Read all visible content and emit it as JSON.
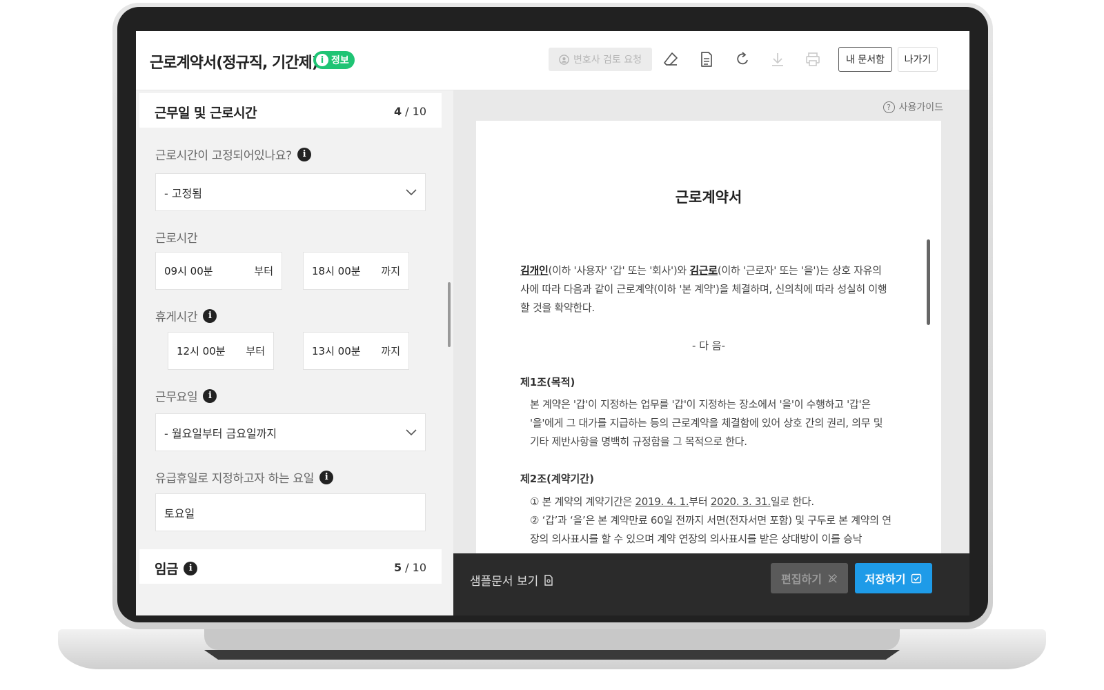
{
  "header": {
    "title": "근로계약서(정규직, 기간제)",
    "info_badge": "정보",
    "lawyer_review": "변호사 검토 요청",
    "my_docs": "내 문서함",
    "exit": "나가기"
  },
  "section4": {
    "title": "근무일 및 근로시간",
    "progress_current": "4",
    "progress_total": " / 10",
    "q_fixed": "근로시간이 고정되어있나요?",
    "fixed_value": "- 고정됨",
    "work_hours_label": "근로시간",
    "work_from": "09시 00분",
    "work_from_suffix": "부터",
    "work_to": "18시 00분",
    "work_to_suffix": "까지",
    "break_label": "휴게시간",
    "break_from": "12시 00분",
    "break_from_suffix": "부터",
    "break_to": "13시 00분",
    "break_to_suffix": "까지",
    "workdays_label": "근무요일",
    "workdays_value": "- 월요일부터 금요일까지",
    "paid_holiday_label": "유급휴일로 지정하고자 하는 요일",
    "paid_holiday_value": "토요일"
  },
  "section5": {
    "title": "임금",
    "progress_current": "5",
    "progress_total": " / 10"
  },
  "preview": {
    "guide": "사용가이드",
    "doc_title": "근로계약서",
    "employer": "김개인",
    "intro_a": "(이하 '사용자' '갑' 또는 '회사')와 ",
    "employee": "김근로",
    "intro_b": "(이하 '근로자' 또는 '을')는 상호 자유의 사에 따라 다음과 같이 근로계약(이하 '본 계약')을 체결하며, 신의칙에 따라 성실히 이행할 것을 확약한다.",
    "divider": "- 다 음-",
    "art1_title": "제1조(목적)",
    "art1_body": "본 계약은 '갑'이 지정하는 업무를 '갑'이 지정하는 장소에서 '을'이 수행하고 '갑'은 '을'에게 그 대가를 지급하는 등의 근로계약을 체결함에 있어 상호 간의 권리, 의무 및 기타 제반사항을 명백히 규정함을 그 목적으로 한다.",
    "art2_title": "제2조(계약기간)",
    "art2_item1_a": "① 본 계약의 계약기간은 ",
    "art2_start": "2019. 4. 1.",
    "art2_item1_b": "부터 ",
    "art2_end": "2020. 3. 31.",
    "art2_item1_c": "일로 한다.",
    "art2_item2": "② ‘갑’과 ‘을’은 본 계약만료 60일 전까지 서면(전자서면 포함) 및 구두로 본 계약의 연장의 의사표시를 할 수 있으며 계약 연장의 의사표시를 받은 상대방이 이를 승낙"
  },
  "footer": {
    "sample": "샘플문서 보기",
    "edit": "편집하기",
    "save": "저장하기"
  },
  "colors": {
    "accent_green": "#1fc474",
    "accent_blue": "#1e9be8"
  }
}
